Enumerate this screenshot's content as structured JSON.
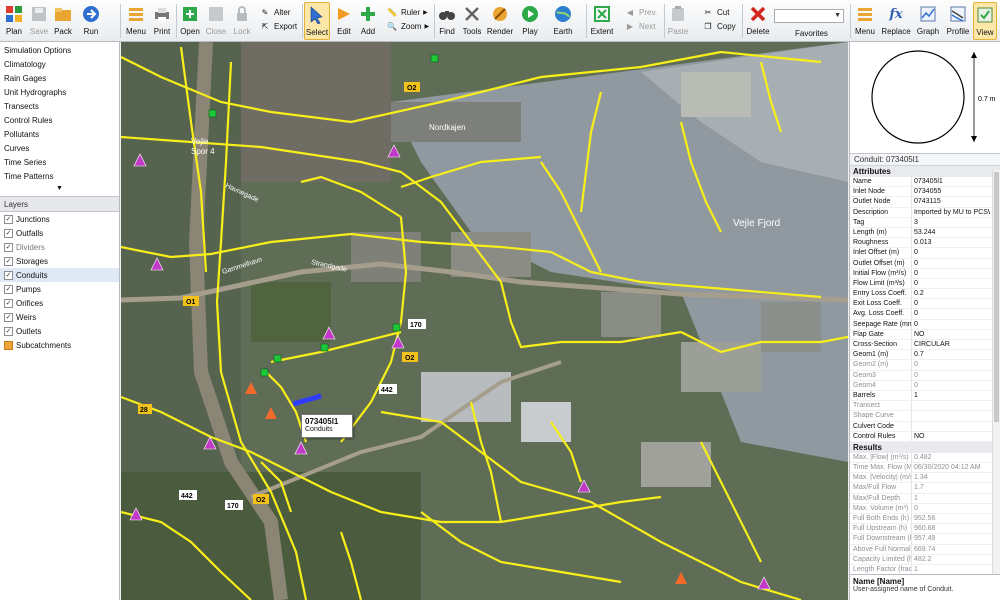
{
  "toolbar": {
    "plan": "Plan",
    "save": "Save",
    "pack": "Pack",
    "run": "Run",
    "menu": "Menu",
    "print": "Print",
    "open": "Open",
    "close": "Close",
    "lock": "Lock",
    "alter": "Alter",
    "export": "Export",
    "select": "Select",
    "edit": "Edit",
    "add": "Add",
    "ruler": "Ruler",
    "zoom": "Zoom",
    "find": "Find",
    "tools": "Tools",
    "render": "Render",
    "play": "Play",
    "earth": "Earth",
    "extent": "Extent",
    "prev": "Prev.",
    "next": "Next",
    "paste": "Paste",
    "cut": "Cut",
    "copy": "Copy",
    "delete": "Delete",
    "favorites": "Favorites",
    "menu2": "Menu",
    "replace": "Replace",
    "graph": "Graph",
    "profile": "Profile",
    "view": "View"
  },
  "nav": {
    "items": [
      "Simulation Options",
      "Climatology",
      "Rain Gages",
      "Unit Hydrographs",
      "Transects",
      "Control Rules",
      "Pollutants",
      "Curves",
      "Time Series",
      "Time Patterns"
    ],
    "more_arrow": "▼"
  },
  "layers": {
    "header": "Layers",
    "items": [
      {
        "label": "Junctions",
        "checked": "✓"
      },
      {
        "label": "Outfalls",
        "checked": "✓"
      },
      {
        "label": "Dividers",
        "checked": "✓"
      },
      {
        "label": "Storages",
        "checked": "✓"
      },
      {
        "label": "Conduits",
        "checked": "✓"
      },
      {
        "label": "Pumps",
        "checked": "✓"
      },
      {
        "label": "Orifices",
        "checked": "✓"
      },
      {
        "label": "Weirs",
        "checked": "✓"
      },
      {
        "label": "Outlets",
        "checked": "✓"
      },
      {
        "label": "Subcatchments",
        "checked": ""
      }
    ],
    "highlighted": "Conduits"
  },
  "map": {
    "tooltip_name": "073405l1",
    "tooltip_type": "Conduits",
    "labels": {
      "vejle": "Vejle",
      "spor": "Spor 4",
      "nordkajen": "Nordkajen",
      "vejle_fjord": "Vejle Fjord",
      "havnegade": "Havnegade",
      "gammelhavn": "Gammelhavn",
      "strandgade": "Strandgade",
      "o1": "O1",
      "o2a": "O2",
      "o2b": "O2",
      "r170a": "170",
      "r170b": "170",
      "r442a": "442",
      "r442b": "442",
      "r28": "28",
      "o2top": "O2"
    },
    "colors": {
      "conduit": "#f7ee1a",
      "node": "#c238c8",
      "outfall": "#1fc83a",
      "water": "#9fa8ad",
      "land": "#65735c"
    }
  },
  "cross_section": {
    "dimension": "0.7 m",
    "shape": "CIRCULAR"
  },
  "properties": {
    "object_title": "Conduit: 073405l1",
    "attributes_label": "Attributes",
    "attributes": [
      {
        "n": "Name",
        "v": "073405l1",
        "dim": false
      },
      {
        "n": "Inlet Node",
        "v": "0734055",
        "dim": false
      },
      {
        "n": "Outlet Node",
        "v": "0743115",
        "dim": false
      },
      {
        "n": "Description",
        "v": "Imported by MU to PCSWMM",
        "dim": false
      },
      {
        "n": "Tag",
        "v": "3",
        "dim": false
      },
      {
        "n": "Length (m)",
        "v": "53.244",
        "dim": false
      },
      {
        "n": "Roughness",
        "v": "0.013",
        "dim": false
      },
      {
        "n": "Inlet Offset (m)",
        "v": "0",
        "dim": false
      },
      {
        "n": "Outlet Offset (m)",
        "v": "0",
        "dim": false
      },
      {
        "n": "Initial Flow (m³/s)",
        "v": "0",
        "dim": false
      },
      {
        "n": "Flow Limit (m³/s)",
        "v": "0",
        "dim": false
      },
      {
        "n": "Entry Loss Coeff.",
        "v": "0.2",
        "dim": false
      },
      {
        "n": "Exit Loss Coeff.",
        "v": "0",
        "dim": false
      },
      {
        "n": "Avg. Loss Coeff.",
        "v": "0",
        "dim": false
      },
      {
        "n": "Seepage Rate (mm/hr)",
        "v": "0",
        "dim": false
      },
      {
        "n": "Flap Gate",
        "v": "NO",
        "dim": false
      },
      {
        "n": "Cross-Section",
        "v": "CIRCULAR",
        "dim": false
      },
      {
        "n": "Geom1 (m)",
        "v": "0.7",
        "dim": false
      },
      {
        "n": "Geom2 (m)",
        "v": "0",
        "dim": true
      },
      {
        "n": "Geom3",
        "v": "0",
        "dim": true
      },
      {
        "n": "Geom4",
        "v": "0",
        "dim": true
      },
      {
        "n": "Barrels",
        "v": "1",
        "dim": false
      },
      {
        "n": "Transect",
        "v": "",
        "dim": true
      },
      {
        "n": "Shape Curve",
        "v": "",
        "dim": true
      },
      {
        "n": "Culvert Code",
        "v": "",
        "dim": false
      },
      {
        "n": "Control Rules",
        "v": "NO",
        "dim": false
      }
    ],
    "results_label": "Results",
    "results": [
      {
        "n": "Max. |Flow| (m³/s)",
        "v": "0.482",
        "dim": true
      },
      {
        "n": "Time Max. Flow (M...",
        "v": "06/30/2020 04:12 AM",
        "dim": true
      },
      {
        "n": "Max. |Velocity| (m/s)",
        "v": "1.34",
        "dim": true
      },
      {
        "n": "Max/Full Flow",
        "v": "1.7",
        "dim": true
      },
      {
        "n": "Max/Full Depth",
        "v": "1",
        "dim": true
      },
      {
        "n": "Max. Volume (m³)",
        "v": "0",
        "dim": true
      },
      {
        "n": "Full Both Ends (h)",
        "v": "952.56",
        "dim": true
      },
      {
        "n": "Full Upstream (h)",
        "v": "960.68",
        "dim": true
      },
      {
        "n": "Full Downstream (h)",
        "v": "957.49",
        "dim": true
      },
      {
        "n": "Above Full Normal",
        "v": "669.74",
        "dim": true
      },
      {
        "n": "Capacity Limited (h)",
        "v": "482.2",
        "dim": true
      },
      {
        "n": "Length Factor (frac)",
        "v": "1",
        "dim": true
      }
    ]
  },
  "description_box": {
    "title": "Name [Name]",
    "text": "User-assigned name of Conduit."
  }
}
